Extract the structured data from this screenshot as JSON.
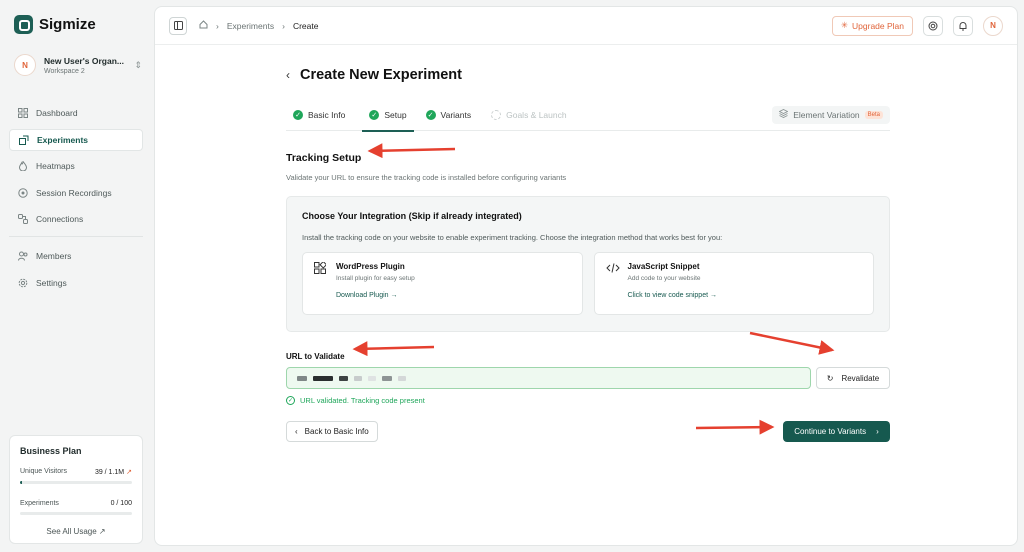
{
  "app": {
    "name": "Sigmize"
  },
  "org": {
    "initial": "N",
    "name": "New User's Organ...",
    "workspace": "Workspace 2"
  },
  "nav": {
    "items": [
      {
        "label": "Dashboard",
        "icon": "dashboard-icon"
      },
      {
        "label": "Experiments",
        "icon": "experiments-icon",
        "active": true
      },
      {
        "label": "Heatmaps",
        "icon": "flame-icon"
      },
      {
        "label": "Session Recordings",
        "icon": "record-icon"
      },
      {
        "label": "Connections",
        "icon": "connections-icon"
      }
    ],
    "items2": [
      {
        "label": "Members",
        "icon": "users-icon"
      },
      {
        "label": "Settings",
        "icon": "gear-icon"
      }
    ]
  },
  "plan": {
    "title": "Business Plan",
    "visitors_label": "Unique Visitors",
    "visitors_value": "39 / 1.1M",
    "visitors_fraction": 3.54e-05,
    "experiments_label": "Experiments",
    "experiments_value": "0 / 100",
    "experiments_fraction": 0,
    "link": "See All Usage ↗"
  },
  "topbar": {
    "crumb_1": "Experiments",
    "crumb_2": "Create",
    "upgrade": "Upgrade Plan",
    "user_initial": "N"
  },
  "page": {
    "title": "Create New Experiment"
  },
  "tabs": [
    {
      "label": "Basic Info",
      "state": "done"
    },
    {
      "label": "Setup",
      "state": "active"
    },
    {
      "label": "Variants",
      "state": "done"
    },
    {
      "label": "Goals & Launch",
      "state": "disabled"
    }
  ],
  "element_variation": {
    "label": "Element Variation",
    "badge": "Beta"
  },
  "tracking": {
    "title": "Tracking Setup",
    "subtitle": "Validate your URL to ensure the tracking code is installed before configuring variants"
  },
  "integration": {
    "title": "Choose Your Integration (Skip if already integrated)",
    "subtitle": "Install the tracking code on your website to enable experiment tracking. Choose the integration method that works best for you:",
    "cards": [
      {
        "title": "WordPress Plugin",
        "desc": "Install plugin for easy setup",
        "link": "Download Plugin →",
        "icon": "plugin-icon"
      },
      {
        "title": "JavaScript Snippet",
        "desc": "Add code to your website",
        "link": "Click to view code snippet →",
        "icon": "code-icon"
      }
    ]
  },
  "url": {
    "label": "URL to Validate",
    "revalidate": "Revalidate",
    "status": "URL validated. Tracking code present"
  },
  "actions": {
    "back": "Back to Basic Info",
    "continue": "Continue to Variants"
  },
  "colors": {
    "brand": "#16594f",
    "accent": "#e0643a",
    "success": "#1fa65a",
    "annotation": "#e5402f"
  }
}
